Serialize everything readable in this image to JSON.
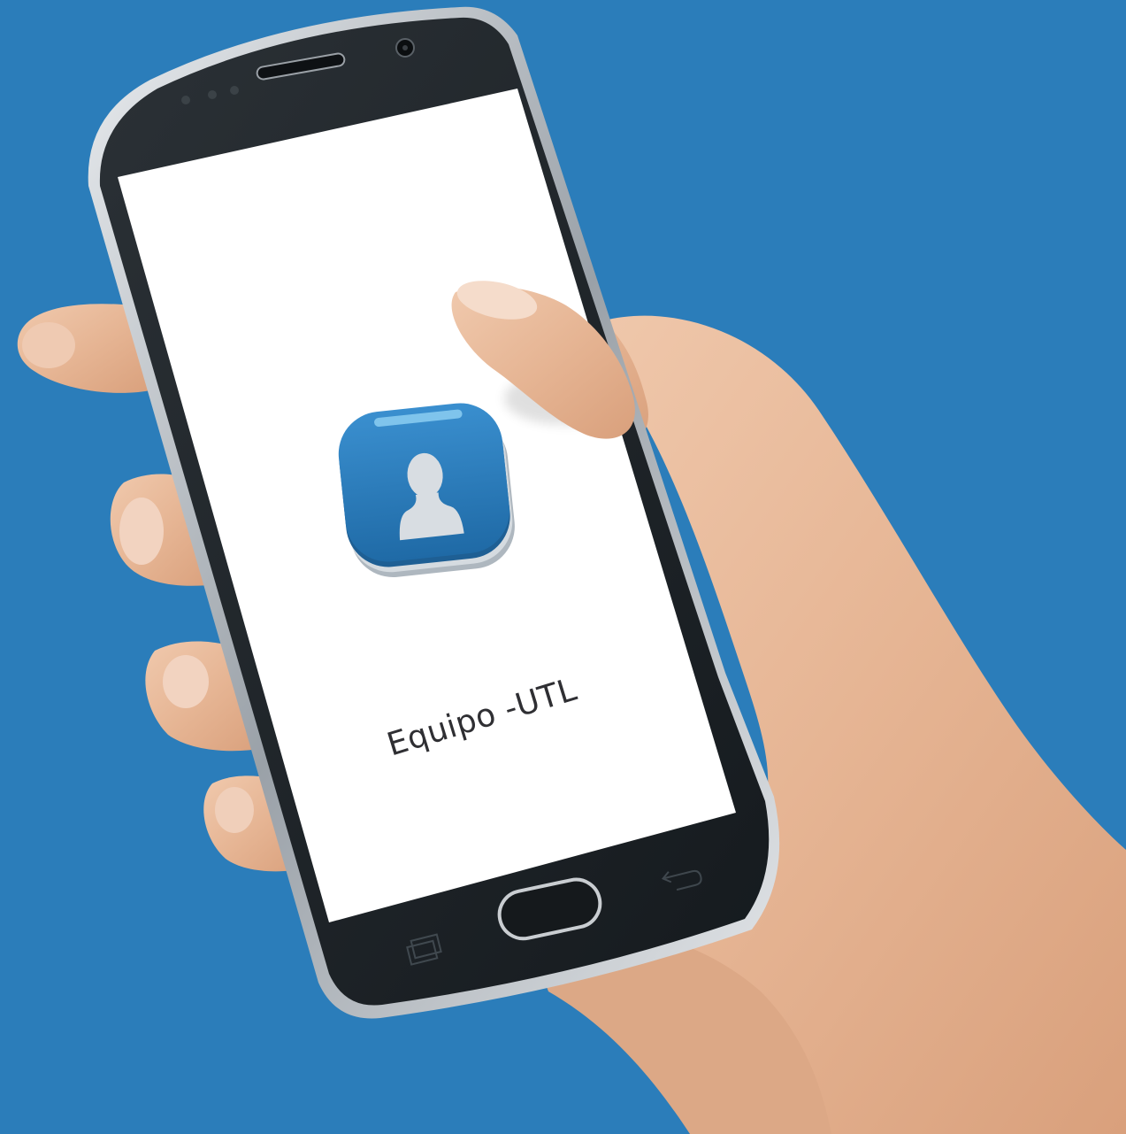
{
  "app": {
    "label": "Equipo -UTL",
    "icon": "contact-person-icon"
  },
  "colors": {
    "background": "#2b7dba",
    "screen": "#ffffff",
    "phone_body": "#1f2428",
    "icon_blue": "#2e7fbf",
    "text": "#2f2f33"
  },
  "device": {
    "nav_icons": [
      "recent-apps-icon",
      "home-button",
      "back-icon"
    ]
  }
}
